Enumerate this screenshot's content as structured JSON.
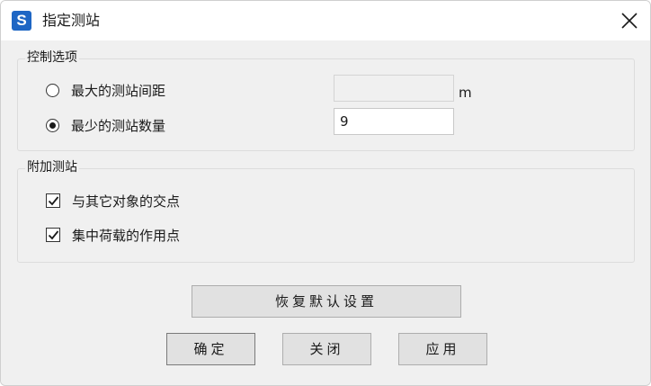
{
  "window": {
    "app_icon_letter": "S",
    "title": "指定测站",
    "close_icon": "close-icon"
  },
  "control_group": {
    "label": "控制选项",
    "options": [
      {
        "label": "最大的测站间距",
        "selected": false
      },
      {
        "label": "最少的测站数量",
        "selected": true
      }
    ],
    "max_spacing": {
      "value": "",
      "unit": "m",
      "enabled": false
    },
    "min_count": {
      "value": "9"
    }
  },
  "additional_group": {
    "label": "附加测站",
    "checks": [
      {
        "label": "与其它对象的交点",
        "checked": true
      },
      {
        "label": "集中荷载的作用点",
        "checked": true
      }
    ]
  },
  "buttons": {
    "restore_defaults": "恢复默认设置",
    "ok": "确定",
    "close": "关闭",
    "apply": "应用"
  },
  "colors": {
    "app_icon": "#1e66c4",
    "dialog_bg": "#f0f0f0",
    "button_bg": "#e1e1e1"
  }
}
